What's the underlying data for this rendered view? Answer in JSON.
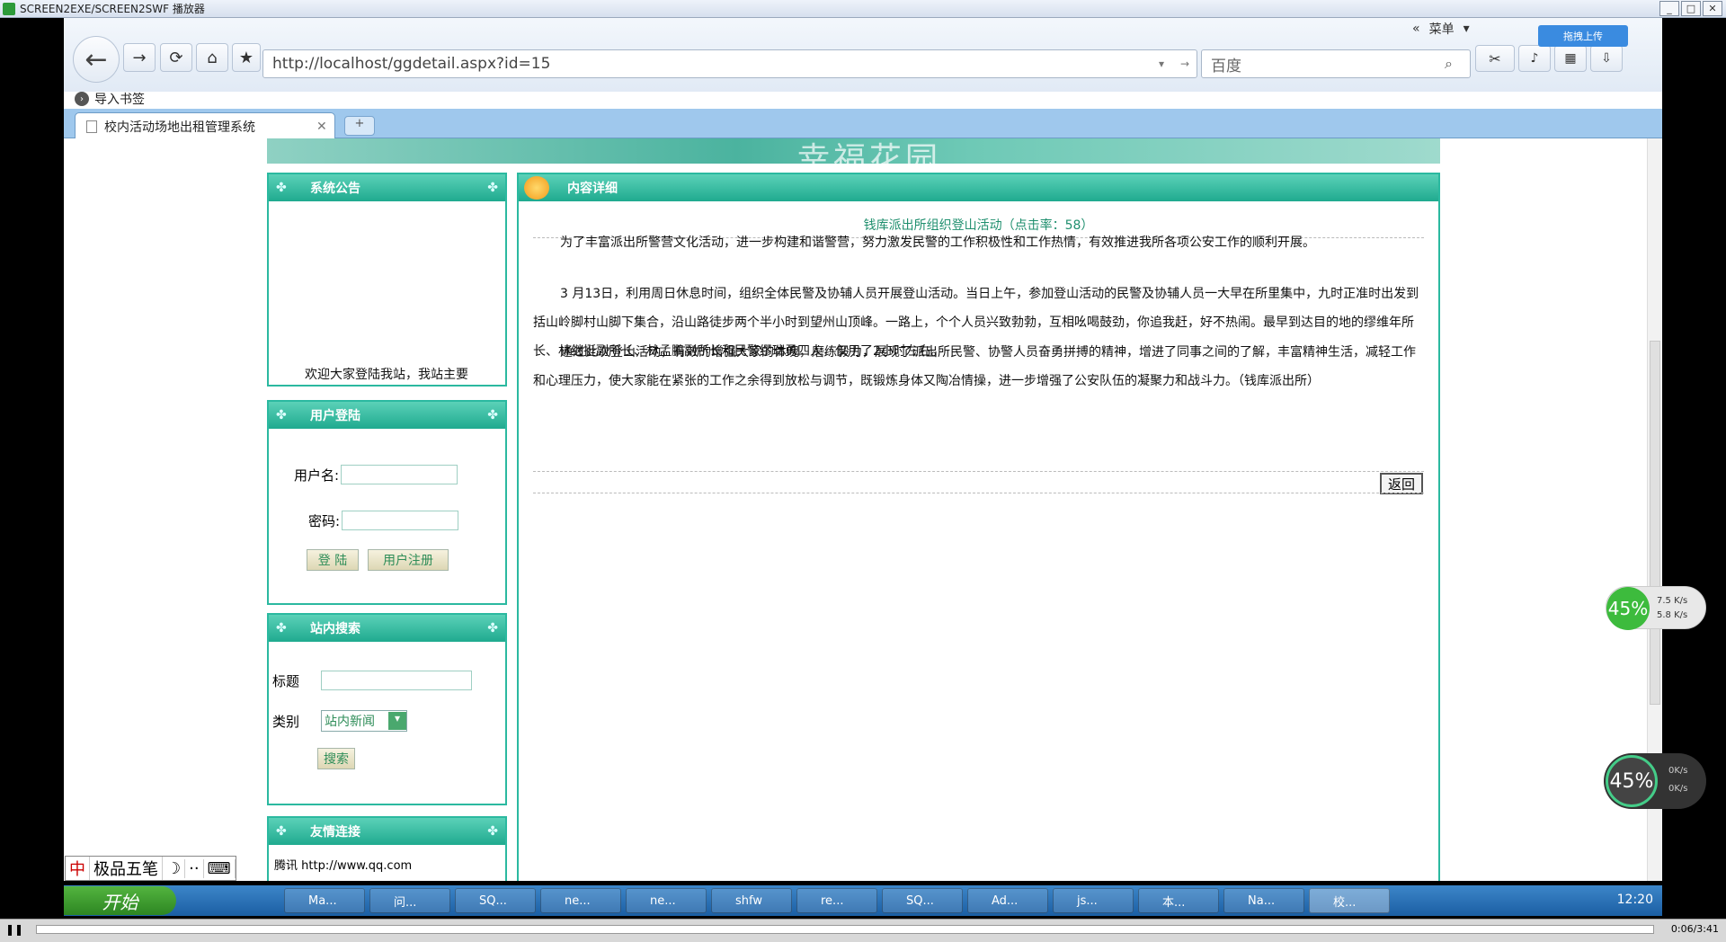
{
  "outer": {
    "title": "SCREEN2EXE/SCREEN2SWF 播放器"
  },
  "toolbar": {
    "url": "http://localhost/ggdetail.aspx?id=15",
    "search_placeholder": "百度",
    "menu_label": "菜单",
    "upload_label": "拖拽上传",
    "bookmark_label": "导入书签"
  },
  "tab": {
    "label": "校内活动场地出租管理系统"
  },
  "banner": {
    "text": "幸福花园"
  },
  "sidebar": {
    "notice_title": "系统公告",
    "notice_text": "欢迎大家登陆我站，我站主要",
    "login_title": "用户登陆",
    "username_label": "用户名:",
    "password_label": "密码:",
    "login_button": "登 陆",
    "register_button": "用户注册",
    "search_title": "站内搜索",
    "search_title_label": "标题",
    "search_category_label": "类别",
    "search_category_value": "站内新闻",
    "search_button": "搜索",
    "links_title": "友情连接",
    "link_item": "腾讯 http://www.qq.com"
  },
  "article": {
    "panel_title": "内容详细",
    "title": "钱库派出所组织登山活动（点击率：58）",
    "p1": "为了丰富派出所警营文化活动，进一步构建和谐警营，努力激发民警的工作积极性和工作热情，有效推进我所各项公安工作的顺利开展。",
    "p2": "3 月13日，利用周日休息时间，组织全体民警及协辅人员开展登山活动。当日上午，参加登山活动的民警及协辅人员一大早在所里集中，九时正准时出发到括山岭脚村山脚下集合，沿山路徒步两个半小时到望州山顶峰。一路上，个个人员兴致勃勃，互相吆喝鼓劲，你追我赶，好不热闹。最早到达目的地的缪维年所长、林继挺副所长、林孟鹏副所长和民警缪瑞勇四人，仅用了2小时左右。",
    "p3": "通过此次登山活动，有效的增强大家的体魄，磨练毅力，展现了派出所民警、协警人员奋勇拼搏的精神，增进了同事之间的了解，丰富精神生活，减轻工作和心理压力，使大家能在紧张的工作之余得到放松与调节，既锻炼身体又陶冶情操，进一步增强了公安队伍的凝聚力和战斗力。（钱库派出所）",
    "back_label": "返回"
  },
  "speed": {
    "pct1": "45%",
    "up1": "7.5 K/s",
    "down1": "5.8 K/s",
    "pct2": "45%",
    "up2": "0K/s",
    "down2": "0K/s"
  },
  "ime": {
    "label": "极品五笔"
  },
  "taskbar": {
    "start": "开始",
    "items": [
      "Ma...",
      "问...",
      "SQ...",
      "ne...",
      "ne...",
      "shfw",
      "re...",
      "SQ...",
      "Ad...",
      "js...",
      "本...",
      "Na...",
      "校..."
    ],
    "clock": "12:20"
  },
  "player": {
    "time": "0:06/3:41"
  }
}
